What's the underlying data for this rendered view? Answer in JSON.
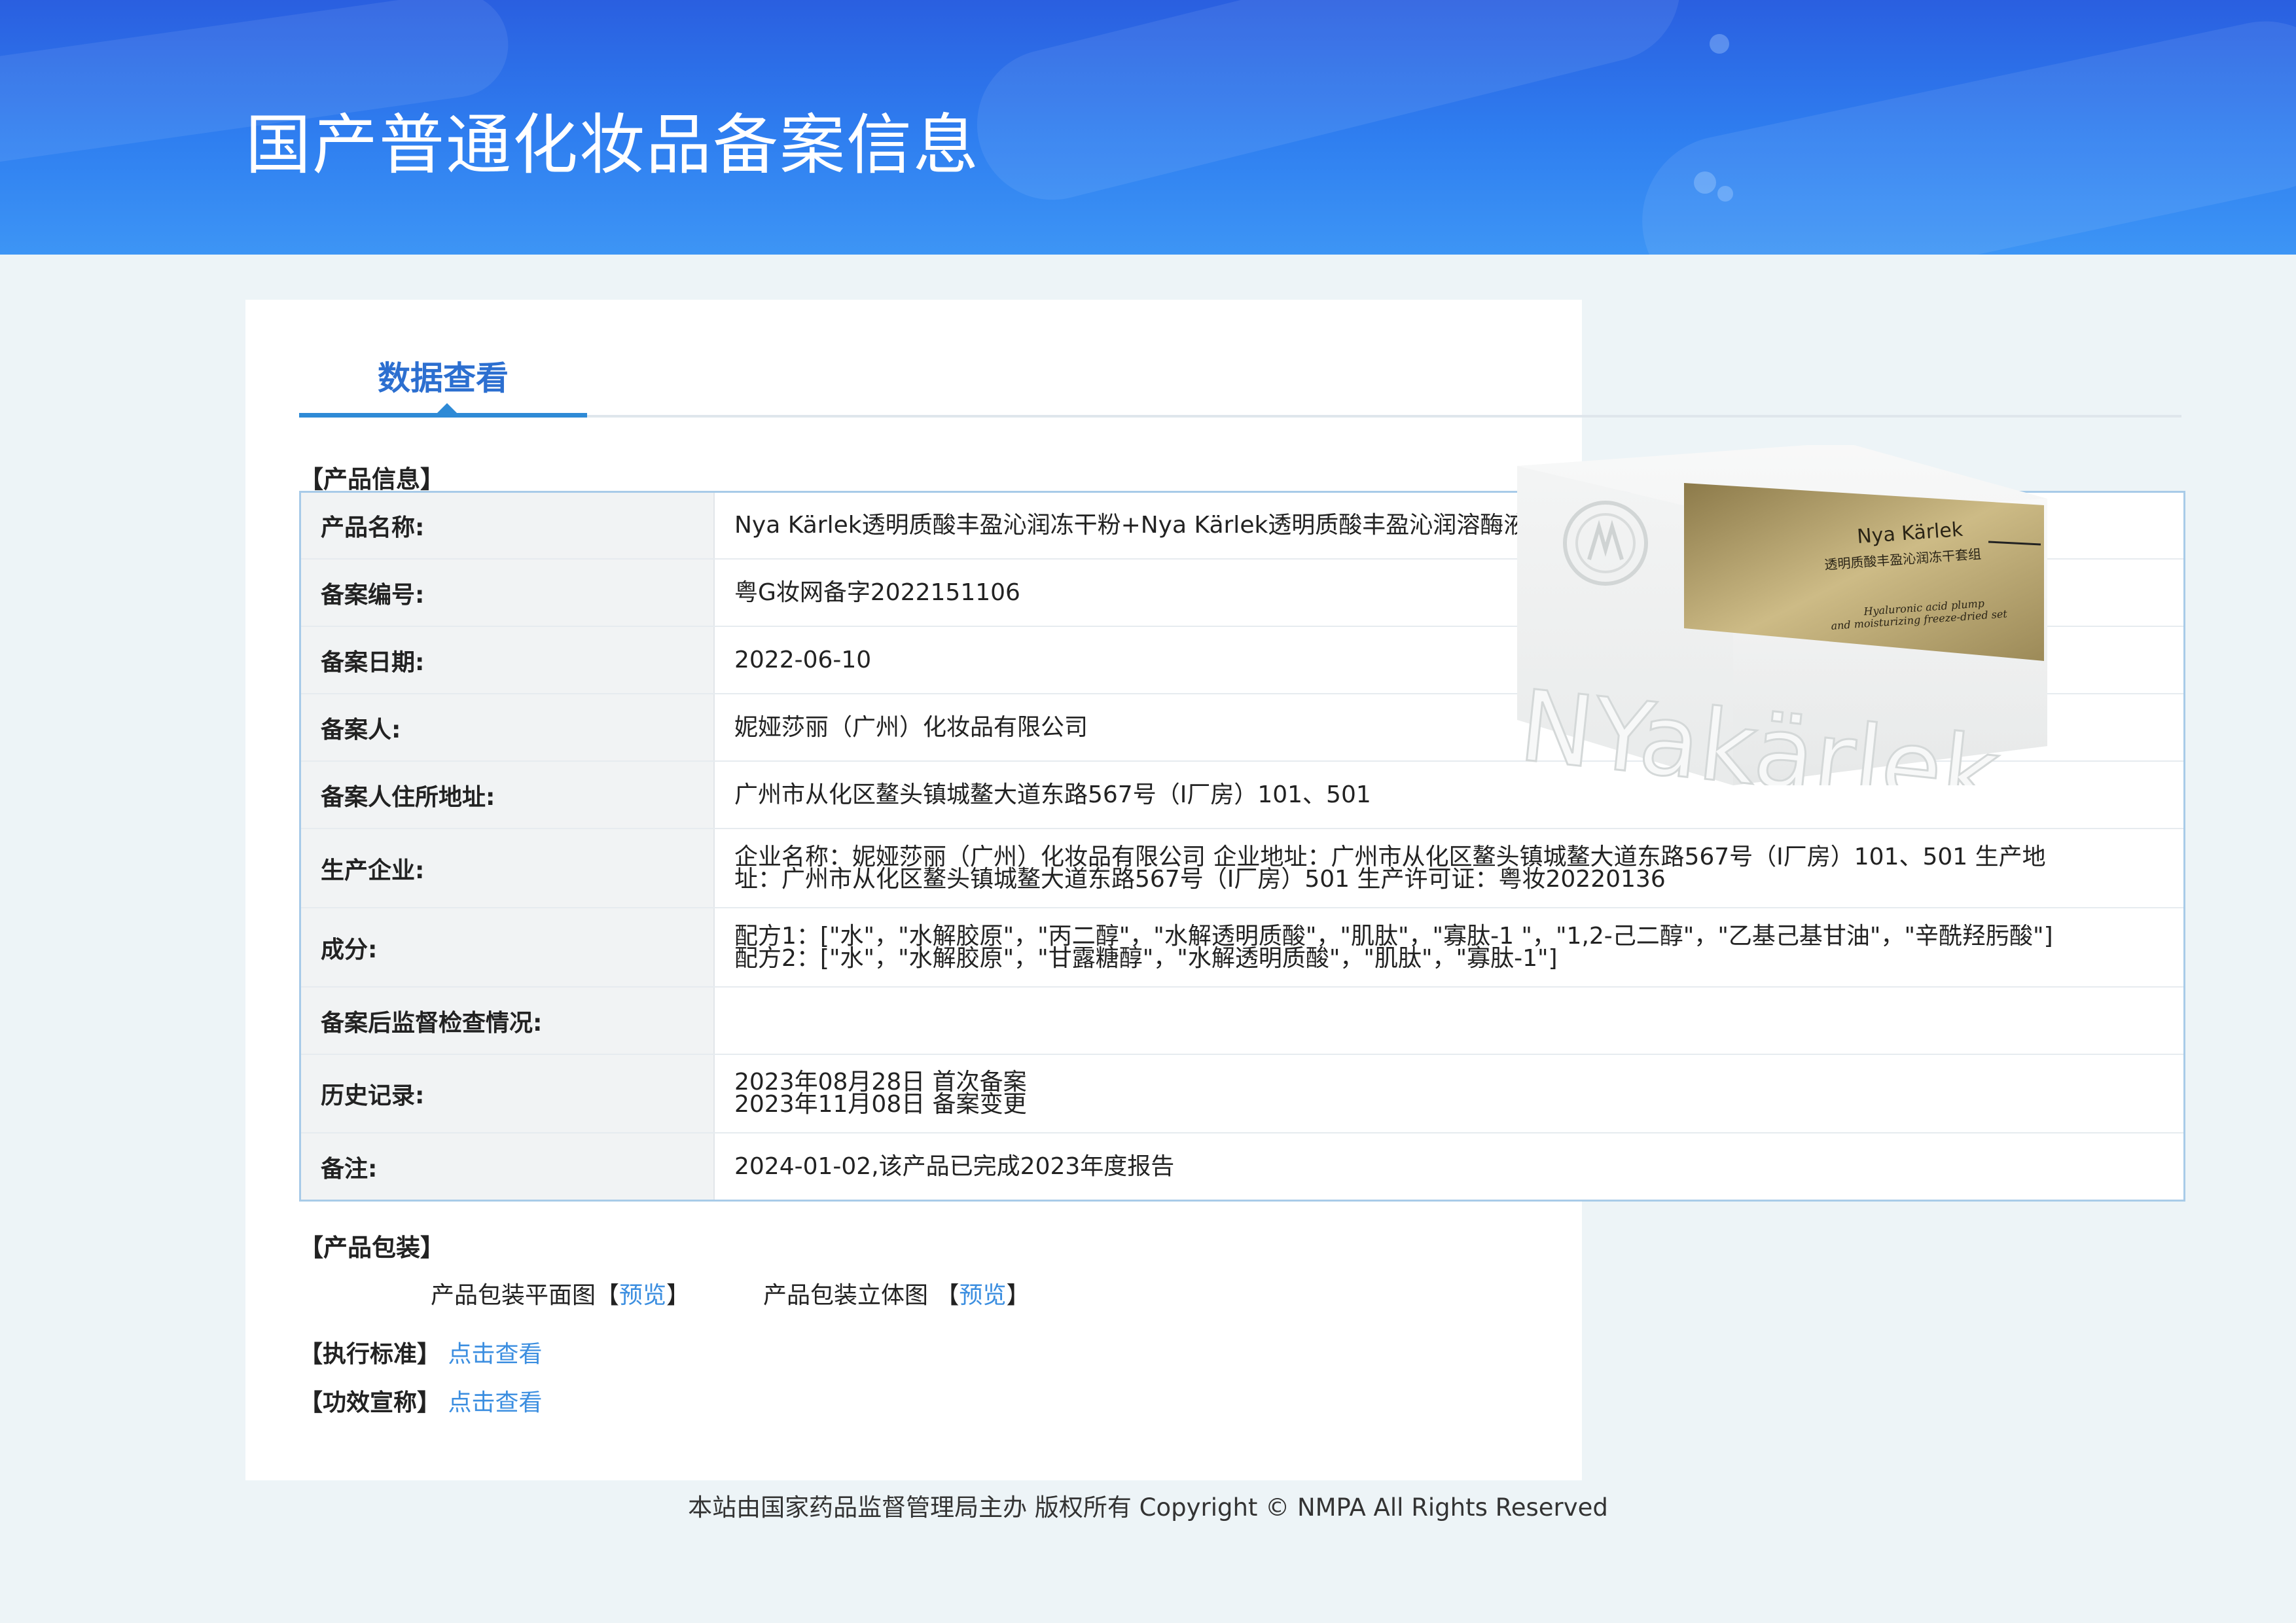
{
  "header": {
    "title": "国产普通化妆品备案信息"
  },
  "tabs": [
    {
      "label": "数据查看",
      "active": true
    }
  ],
  "product_info": {
    "section_title": "【产品信息】",
    "rows": [
      {
        "label": "产品名称:",
        "value": "Nya Kärlek透明质酸丰盈沁润冻干粉+Nya Kärlek透明质酸丰盈沁润溶酶液"
      },
      {
        "label": "备案编号:",
        "value": "粤G妆网备字2022151106"
      },
      {
        "label": "备案日期:",
        "value": "2022-06-10"
      },
      {
        "label": "备案人:",
        "value": "妮娅莎丽（广州）化妆品有限公司"
      },
      {
        "label": "备案人住所地址:",
        "value": "广州市从化区鳌头镇城鳌大道东路567号（I厂房）101、501"
      },
      {
        "label": "生产企业:",
        "value": "企业名称：妮娅莎丽（广州）化妆品有限公司 企业地址：广州市从化区鳌头镇城鳌大道东路567号（I厂房）101、501 生产地址：广州市从化区鳌头镇城鳌大道东路567号（I厂房）501 生产许可证：粤妆20220136"
      },
      {
        "label": "成分:",
        "lines": [
          "配方1：[\"水\"，\"水解胶原\"，\"丙二醇\"，\"水解透明质酸\"，\"肌肽\"，\"寡肽-1 \"，\"1,2-己二醇\"，\"乙基己基甘油\"，\"辛酰羟肟酸\"]",
          "配方2：[\"水\"，\"水解胶原\"，\"甘露糖醇\"，\"水解透明质酸\"，\"肌肽\"，\"寡肽-1\"]"
        ]
      },
      {
        "label": "备案后监督检查情况:",
        "value": ""
      },
      {
        "label": "历史记录:",
        "lines": [
          "2023年08月28日 首次备案",
          "2023年11月08日 备案变更"
        ]
      },
      {
        "label": "备注:",
        "value": "2024-01-02,该产品已完成2023年度报告"
      }
    ]
  },
  "product_image": {
    "brand_label": "Nya Kärlek",
    "label_cn": "透明质酸丰盈沁润冻干套组",
    "label_en_1": "Hyaluronic acid plump",
    "label_en_2": "and moisturizing freeze-dried set",
    "side_text": "NYakärlek"
  },
  "packaging": {
    "section_title": "【产品包装】",
    "flat_label": "产品包装平面图",
    "stereo_label": "产品包装立体图",
    "bracket_open": "【",
    "bracket_close": "】",
    "preview_link": "预览"
  },
  "standard": {
    "label": "【执行标准】",
    "link": "点击查看"
  },
  "efficacy": {
    "label": "【功效宣称】",
    "link": "点击查看"
  },
  "footer": {
    "text": "本站由国家药品监督管理局主办 版权所有 Copyright © NMPA All Rights Reserved"
  }
}
